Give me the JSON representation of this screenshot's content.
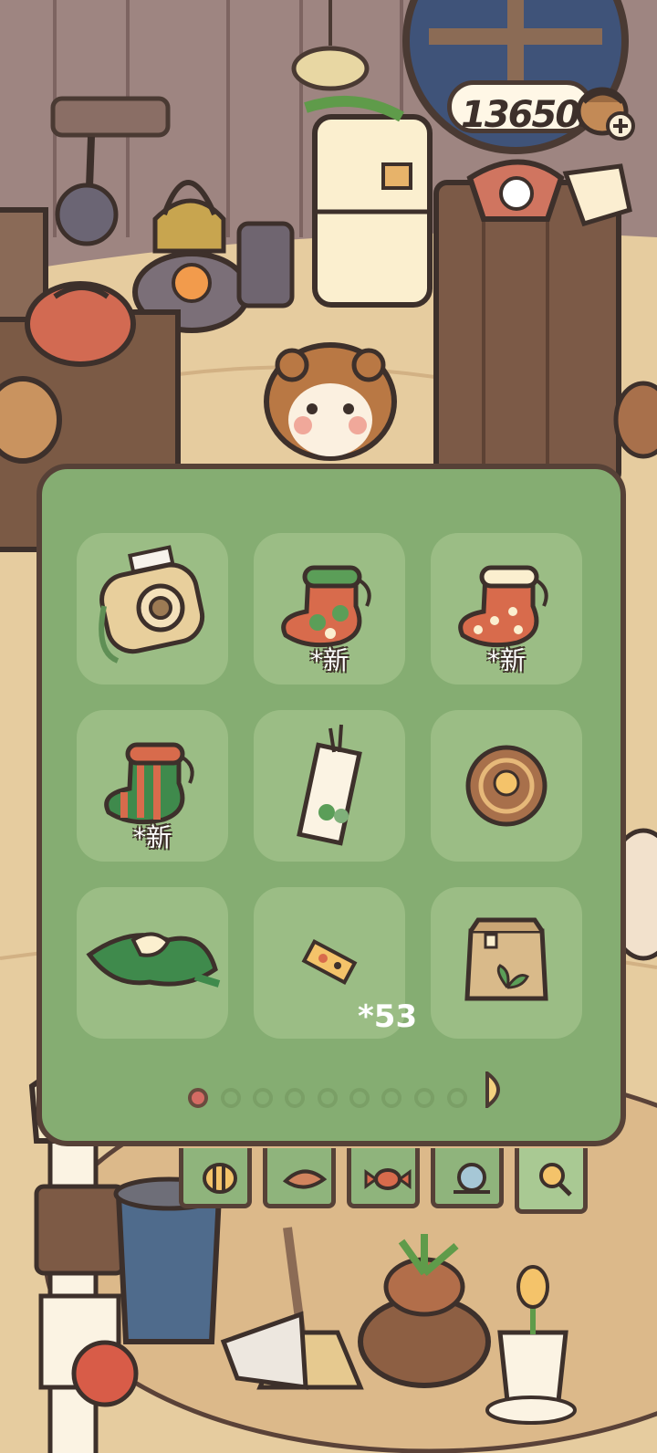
{
  "currency": {
    "amount": "136503",
    "icon": "acorn-coin-plus-icon"
  },
  "inventory": {
    "items": [
      {
        "name": "instant-camera",
        "icon": "camera-icon",
        "badge": ""
      },
      {
        "name": "green-sack",
        "icon": "stocking-icon",
        "badge": "*新"
      },
      {
        "name": "red-dot-sack",
        "icon": "stocking-icon",
        "badge": "*新"
      },
      {
        "name": "striped-sack",
        "icon": "stocking-icon",
        "badge": "*新"
      },
      {
        "name": "bookmark",
        "icon": "bookmark-icon",
        "badge": ""
      },
      {
        "name": "cookie",
        "icon": "cookie-icon",
        "badge": ""
      },
      {
        "name": "green-bundle",
        "icon": "bundle-icon",
        "badge": ""
      },
      {
        "name": "ticket",
        "icon": "ticket-icon",
        "badge": "",
        "count": "*53"
      },
      {
        "name": "paper-bag",
        "icon": "seed-bag-icon",
        "badge": ""
      }
    ],
    "page_count": 9,
    "current_page": 1
  },
  "tabs": [
    {
      "icon": "bee-icon"
    },
    {
      "icon": "leaf-icon"
    },
    {
      "icon": "candy-icon"
    },
    {
      "icon": "snail-icon"
    },
    {
      "icon": "magnifier-icon"
    }
  ],
  "colors": {
    "panel": "#85ad72",
    "slot": "#9bbd85",
    "outline": "#564137",
    "active_dot": "#d46b63"
  }
}
